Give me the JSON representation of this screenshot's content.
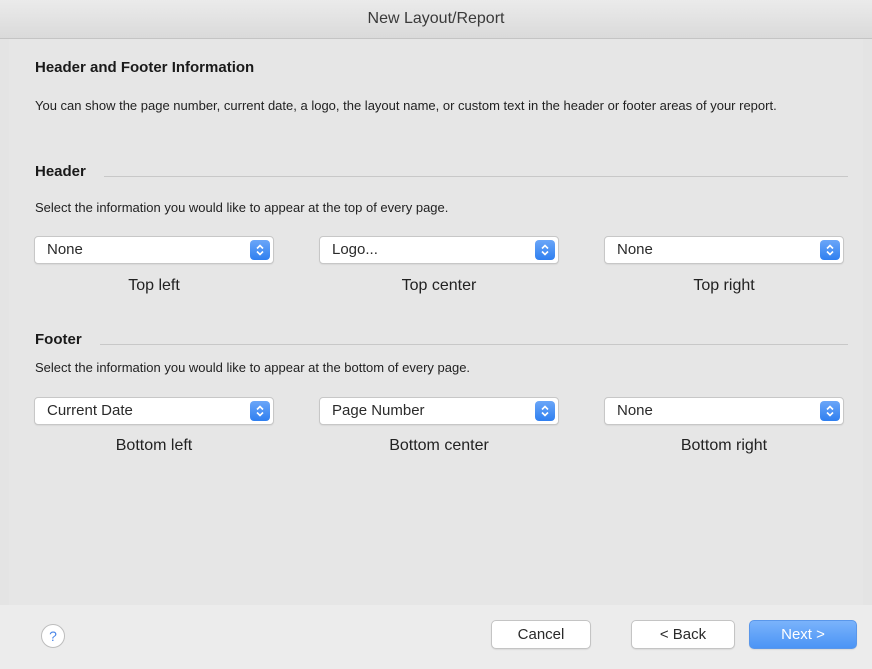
{
  "window": {
    "title": "New Layout/Report"
  },
  "intro": {
    "heading": "Header and Footer Information",
    "description": "You can show the page number, current date, a logo, the layout name, or custom text in the header or footer areas of your report."
  },
  "header": {
    "title": "Header",
    "description": "Select the information you would like to appear at the top of every page.",
    "fields": [
      {
        "value": "None",
        "caption": "Top left"
      },
      {
        "value": "Logo...",
        "caption": "Top center"
      },
      {
        "value": "None",
        "caption": "Top right"
      }
    ]
  },
  "footer": {
    "title": "Footer",
    "description": "Select the information you would like to appear at the bottom of every page.",
    "fields": [
      {
        "value": "Current Date",
        "caption": "Bottom left"
      },
      {
        "value": "Page Number",
        "caption": "Bottom center"
      },
      {
        "value": "None",
        "caption": "Bottom right"
      }
    ]
  },
  "buttons": {
    "help": "?",
    "cancel": "Cancel",
    "back": "< Back",
    "next": "Next >"
  },
  "colors": {
    "accent": "#4b94f5",
    "stepper": "#2f7ff0"
  },
  "icons": {
    "help": "question-mark-icon",
    "stepper": "up-down-chevron-icon"
  }
}
